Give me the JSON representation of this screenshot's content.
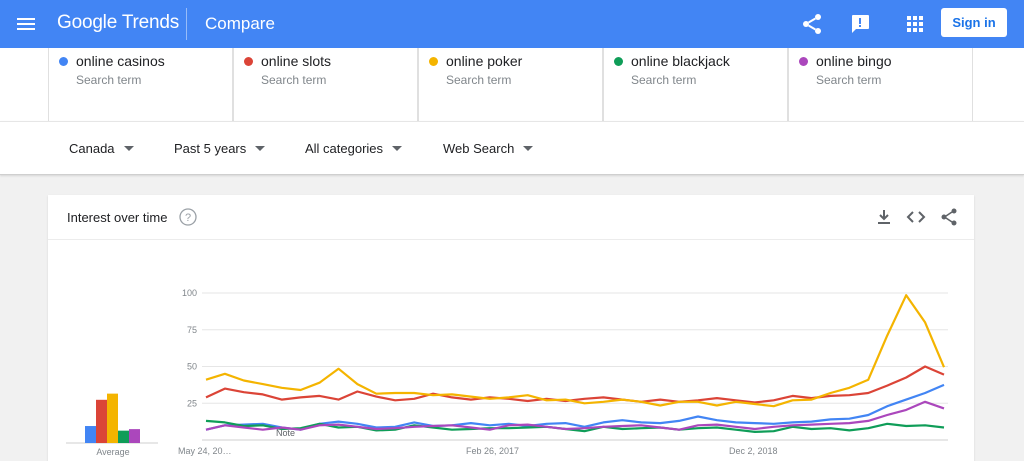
{
  "header": {
    "logo": {
      "part1": "Google",
      "part2": " Trends"
    },
    "title": "Compare",
    "sign_in": "Sign in",
    "icons": [
      "menu-icon",
      "share-icon",
      "feedback-icon",
      "apps-icon"
    ]
  },
  "terms": [
    {
      "name": "online casinos",
      "sub": "Search term",
      "color": "#4285f4"
    },
    {
      "name": "online slots",
      "sub": "Search term",
      "color": "#db4437"
    },
    {
      "name": "online poker",
      "sub": "Search term",
      "color": "#f4b400"
    },
    {
      "name": "online blackjack",
      "sub": "Search term",
      "color": "#0f9d58"
    },
    {
      "name": "online bingo",
      "sub": "Search term",
      "color": "#ab47bc"
    }
  ],
  "filters": {
    "region": "Canada",
    "time": "Past 5 years",
    "category": "All categories",
    "property": "Web Search"
  },
  "card": {
    "title": "Interest over time",
    "icons": [
      "help-icon",
      "download-icon",
      "embed-icon",
      "share-icon"
    ]
  },
  "chart_data": {
    "type": "line",
    "ylim": [
      0,
      100
    ],
    "yticks": [
      "100",
      "75",
      "50",
      "25"
    ],
    "xticks": [
      "May 24, 20…",
      "Feb 26, 2017",
      "Dec 2, 2018"
    ],
    "note_label": "Note",
    "average_label": "Average",
    "average": [
      {
        "name": "online casinos",
        "value": 11,
        "color": "#4285f4"
      },
      {
        "name": "online slots",
        "value": 28,
        "color": "#db4437"
      },
      {
        "name": "online poker",
        "value": 32,
        "color": "#f4b400"
      },
      {
        "name": "online blackjack",
        "value": 8,
        "color": "#0f9d58"
      },
      {
        "name": "online bingo",
        "value": 9,
        "color": "#ab47bc"
      }
    ],
    "series": [
      {
        "name": "online casinos",
        "color": "#4285f4",
        "values": [
          8,
          9,
          10,
          11,
          9,
          8,
          10,
          12,
          11,
          9,
          10,
          11,
          9,
          10,
          12,
          11,
          10,
          9,
          11,
          12,
          10,
          11,
          13,
          12,
          12,
          14,
          15,
          13,
          12,
          12,
          12,
          11,
          12,
          14,
          15,
          18,
          22,
          27,
          32,
          38
        ]
      },
      {
        "name": "online slots",
        "color": "#db4437",
        "values": [
          30,
          34,
          32,
          31,
          28,
          30,
          29,
          27,
          33,
          30,
          28,
          27,
          31,
          29,
          28,
          30,
          27,
          26,
          28,
          27,
          29,
          28,
          27,
          26,
          28,
          27,
          26,
          28,
          27,
          26,
          28,
          29,
          28,
          30,
          31,
          33,
          36,
          42,
          50,
          45
        ]
      },
      {
        "name": "online poker",
        "color": "#f4b400",
        "values": [
          42,
          44,
          40,
          38,
          36,
          35,
          38,
          48,
          38,
          32,
          33,
          31,
          30,
          31,
          30,
          29,
          28,
          30,
          27,
          28,
          26,
          25,
          27,
          26,
          24,
          27,
          25,
          23,
          26,
          25,
          24,
          26,
          27,
          32,
          36,
          42,
          70,
          98,
          80,
          50
        ]
      },
      {
        "name": "online blackjack",
        "color": "#0f9d58",
        "values": [
          14,
          11,
          9,
          10,
          8,
          9,
          10,
          8,
          9,
          7,
          8,
          9,
          8,
          7,
          8,
          9,
          7,
          8,
          9,
          8,
          7,
          8,
          7,
          8,
          9,
          8,
          7,
          8,
          7,
          6,
          7,
          8,
          7,
          8,
          7,
          9,
          10,
          9,
          10,
          9
        ]
      },
      {
        "name": "online bingo",
        "color": "#ab47bc",
        "values": [
          8,
          9,
          8,
          7,
          9,
          8,
          9,
          10,
          9,
          8,
          9,
          8,
          9,
          10,
          9,
          8,
          9,
          10,
          9,
          8,
          9,
          8,
          9,
          10,
          9,
          8,
          9,
          10,
          9,
          8,
          10,
          9,
          10,
          11,
          12,
          14,
          16,
          20,
          26,
          22
        ]
      }
    ]
  }
}
